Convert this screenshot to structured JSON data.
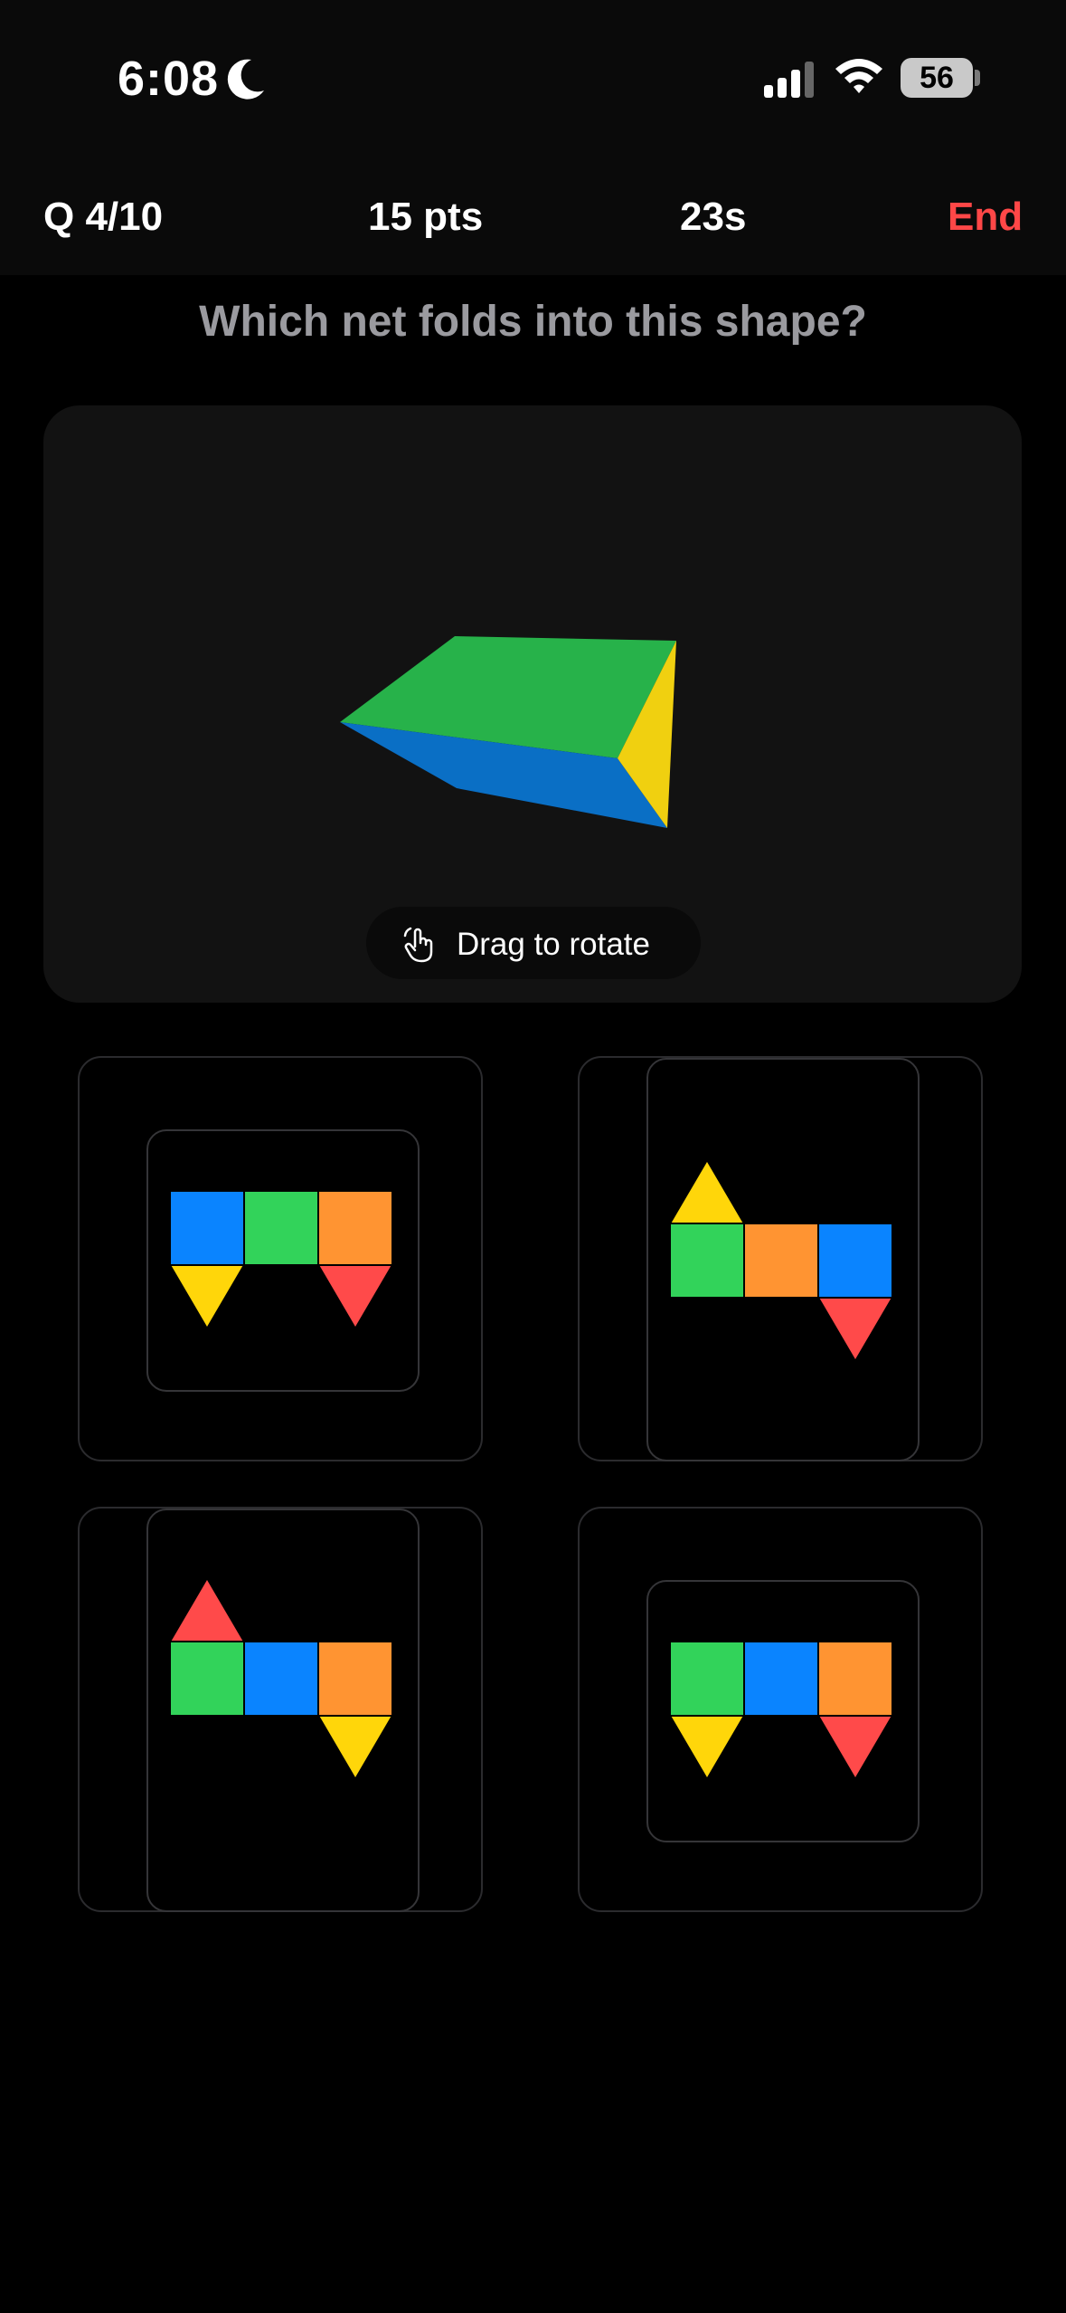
{
  "status": {
    "time": "6:08",
    "battery": "56"
  },
  "topbar": {
    "question_progress": "Q 4/10",
    "points": "15 pts",
    "timer": "23s",
    "end_label": "End"
  },
  "prompt": "Which net folds into this shape?",
  "viewer": {
    "hint": "Drag to rotate",
    "hint_icon": "hand-pointer-icon"
  },
  "colors": {
    "red": "#ff4a4a",
    "yellow": "#ffd60a",
    "green": "#32d35a",
    "blue": "#0a84ff",
    "orange": "#ff9432",
    "end": "#ff4747",
    "solid_green": "#27b24a",
    "solid_blue": "#0a6fc5",
    "solid_yellow": "#f0d010"
  },
  "options": [
    {
      "squares": [
        "blue",
        "green",
        "orange"
      ],
      "triangles": [
        {
          "color": "yellow",
          "attach": "below-first"
        },
        {
          "color": "red",
          "attach": "below-last"
        }
      ]
    },
    {
      "squares": [
        "green",
        "orange",
        "blue"
      ],
      "triangles": [
        {
          "color": "yellow",
          "attach": "above-first"
        },
        {
          "color": "red",
          "attach": "below-last"
        }
      ]
    },
    {
      "squares": [
        "green",
        "blue",
        "orange"
      ],
      "triangles": [
        {
          "color": "red",
          "attach": "above-first"
        },
        {
          "color": "yellow",
          "attach": "below-last"
        }
      ]
    },
    {
      "squares": [
        "green",
        "blue",
        "orange"
      ],
      "triangles": [
        {
          "color": "yellow",
          "attach": "below-first"
        },
        {
          "color": "red",
          "attach": "below-last"
        }
      ]
    }
  ]
}
